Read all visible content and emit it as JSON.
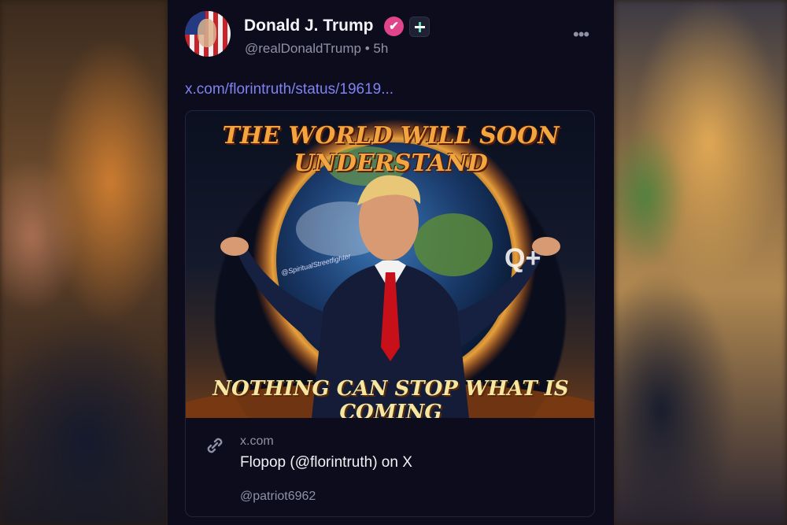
{
  "post": {
    "display_name": "Donald J. Trump",
    "handle": "@realDonaldTrump",
    "time_ago": "5h",
    "link_text": "x.com/florintruth/status/19619..."
  },
  "embed": {
    "image_title": "THE WORLD WILL SOON UNDERSTAND",
    "image_subtitle": "NOTHING CAN STOP WHAT IS COMING",
    "image_watermark": "@SpiritualStreetfighter",
    "image_mark": "Q+",
    "domain": "x.com",
    "title": "Flopop (@florintruth) on X",
    "account": "@patriot6962"
  },
  "icons": {
    "verified": "verified-check-icon",
    "plus": "plus-badge-icon",
    "more": "more-dots-icon",
    "link": "link-icon"
  },
  "colors": {
    "panel_bg": "#0d0c1c",
    "link": "#7f82f0",
    "verified": "#e0458c",
    "muted_text": "#8f92a6"
  }
}
